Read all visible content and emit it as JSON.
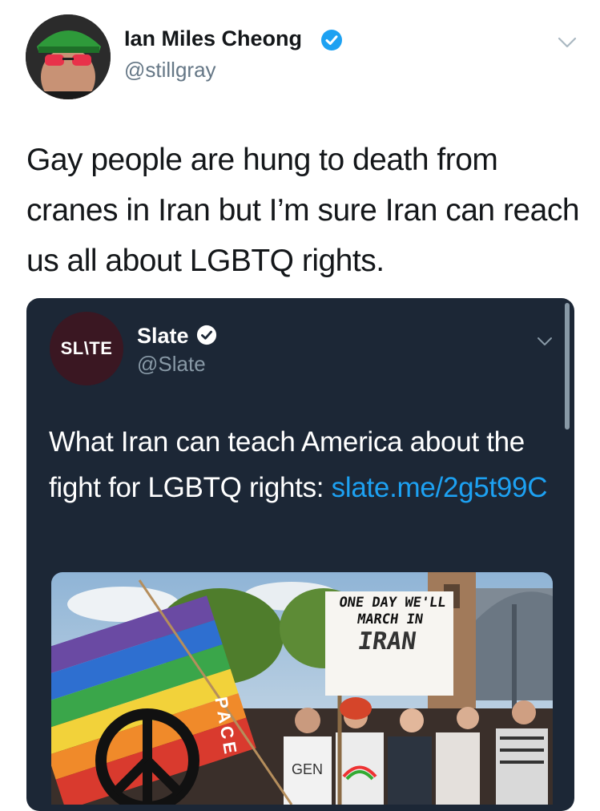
{
  "author": {
    "name": "Ian Miles Cheong",
    "handle": "@stillgray",
    "verified_icon": "verified-badge-icon"
  },
  "tweet": {
    "text": "Gay people are hung to death from cranes in Iran but I’m sure Iran can reach us all about LGBTQ rights."
  },
  "quoted": {
    "name": "Slate",
    "handle": "@Slate",
    "logo_text": "SL\\TE",
    "text": "What Iran can teach America about the fight for LGBTQ rights: ",
    "link": "slate.me/​2g5t99C",
    "media": {
      "sign_lines": [
        "ONE DAY WE'LL",
        "MARCH IN"
      ],
      "sign_emphasis": "IRAN",
      "flag_text": "PACE",
      "shirt_text": "GEN"
    }
  },
  "colors": {
    "verified_blue": "#1da1f2",
    "card_bg": "#1c2736",
    "link": "#1da1f2"
  }
}
